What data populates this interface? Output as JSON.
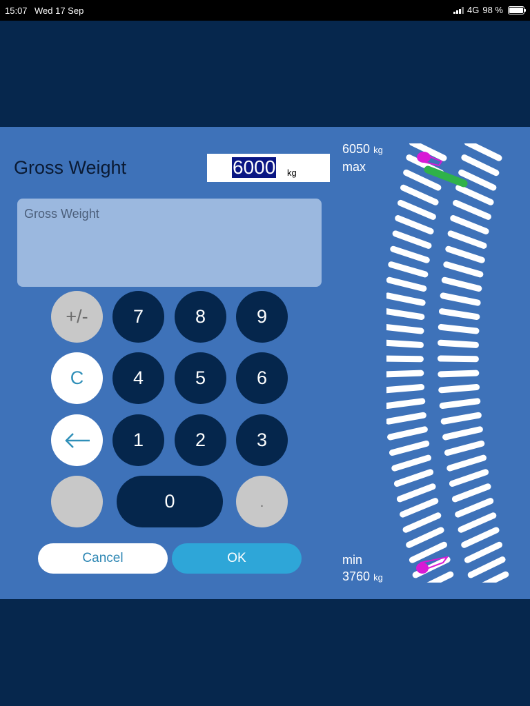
{
  "status_bar": {
    "time": "15:07",
    "date": "Wed 17 Sep",
    "network": "4G",
    "battery": "98 %",
    "battery_level": 0.98
  },
  "dialog": {
    "title": "Gross Weight",
    "value": "6000",
    "unit": "kg",
    "input_placeholder": "Gross Weight",
    "max_value": "6050",
    "max_unit": "kg",
    "max_label": "max",
    "min_label": "min",
    "min_value": "3760",
    "min_unit": "kg"
  },
  "keypad": {
    "plus_minus": "+/-",
    "clear": "C",
    "backspace_icon": "arrow-left-icon",
    "k7": "7",
    "k8": "8",
    "k9": "9",
    "k4": "4",
    "k5": "5",
    "k6": "6",
    "k1": "1",
    "k2": "2",
    "k3": "3",
    "k0": "0",
    "dot": "."
  },
  "actions": {
    "cancel": "Cancel",
    "ok": "OK"
  },
  "colors": {
    "panel": "#3e72b9",
    "background": "#06274d",
    "key_dark": "#05264c",
    "ok": "#2ea6d8",
    "marker_magenta": "#d81ad6",
    "marker_green": "#2fb24a"
  }
}
